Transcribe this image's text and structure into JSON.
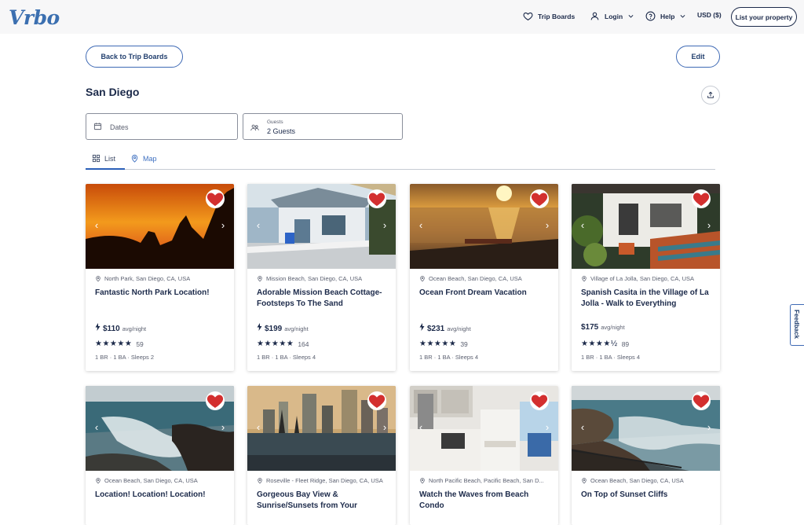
{
  "header": {
    "logo": "Vrbo",
    "trip_boards": "Trip Boards",
    "login": "Login",
    "help": "Help",
    "currency": "USD ($)",
    "list_property": "List your property"
  },
  "toolbar": {
    "back_label": "Back to Trip Boards",
    "edit_label": "Edit"
  },
  "board": {
    "title": "San Diego",
    "dates_placeholder": "Dates",
    "guests_label": "Guests",
    "guests_value": "2 Guests"
  },
  "tabs": {
    "list": "List",
    "map": "Map"
  },
  "cards": [
    {
      "location": "North Park, San Diego, CA, USA",
      "title": "Fantastic North Park Location!",
      "price": "$110",
      "per": "avg/night",
      "stars": "★★★★★",
      "reviews": "59",
      "specs": "1 BR · 1 BA · Sleeps 2",
      "instant": true
    },
    {
      "location": "Mission Beach, San Diego, CA, USA",
      "title": "Adorable Mission Beach Cottage-Footsteps To The Sand",
      "price": "$199",
      "per": "avg/night",
      "stars": "★★★★★",
      "reviews": "164",
      "specs": "1 BR · 1 BA · Sleeps 4",
      "instant": true
    },
    {
      "location": "Ocean Beach, San Diego, CA, USA",
      "title": "Ocean Front Dream Vacation",
      "price": "$231",
      "per": "avg/night",
      "stars": "★★★★★",
      "reviews": "39",
      "specs": "1 BR · 1 BA · Sleeps 4",
      "instant": true
    },
    {
      "location": "Village of La Jolla, San Diego, CA, USA",
      "title": "Spanish Casita in the Village of La Jolla - Walk to Everything",
      "price": "$175",
      "per": "avg/night",
      "stars": "★★★★½",
      "reviews": "89",
      "specs": "1 BR · 1 BA · Sleeps 4",
      "instant": false
    },
    {
      "location": "Ocean Beach, San Diego, CA, USA",
      "title": "Location! Location! Location!"
    },
    {
      "location": "Roseville - Fleet Ridge, San Diego, CA, USA",
      "title": "Gorgeous Bay View & Sunrise/Sunsets from Your"
    },
    {
      "location": "North Pacific Beach, Pacific Beach, San D...",
      "title": "Watch the Waves from Beach Condo"
    },
    {
      "location": "Ocean Beach, San Diego, CA, USA",
      "title": "On Top of Sunset Cliffs"
    }
  ],
  "feedback": "Feedback",
  "colors": {
    "brand": "#3b6fb0",
    "heart": "#d32f2f",
    "navy": "#1c2a4a"
  }
}
